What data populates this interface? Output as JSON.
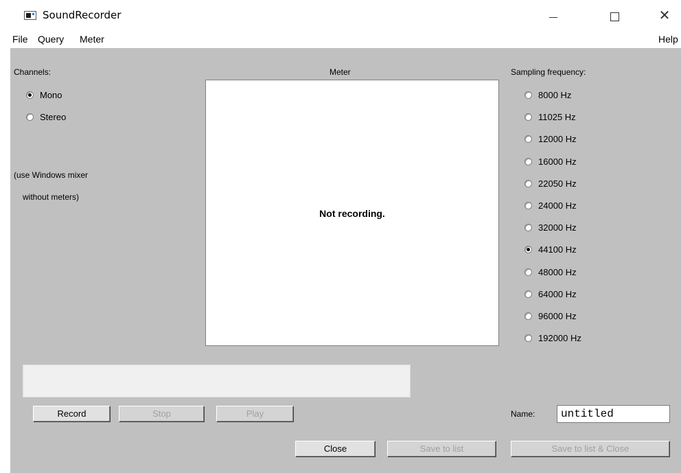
{
  "window": {
    "title": "SoundRecorder",
    "close_glyph": "✕"
  },
  "menu": {
    "items": [
      "File",
      "Query",
      "Meter"
    ],
    "help": "Help"
  },
  "channels": {
    "label": "Channels:",
    "options": [
      {
        "label": "Mono",
        "checked": true
      },
      {
        "label": "Stereo",
        "checked": false
      }
    ],
    "note_line1": "(use Windows mixer",
    "note_line2": "without meters)"
  },
  "meter": {
    "label": "Meter",
    "status": "Not recording."
  },
  "sampling": {
    "label": "Sampling frequency:",
    "options": [
      {
        "label": "8000 Hz",
        "checked": false
      },
      {
        "label": "11025 Hz",
        "checked": false
      },
      {
        "label": "12000 Hz",
        "checked": false
      },
      {
        "label": "16000 Hz",
        "checked": false
      },
      {
        "label": "22050 Hz",
        "checked": false
      },
      {
        "label": "24000 Hz",
        "checked": false
      },
      {
        "label": "32000 Hz",
        "checked": false
      },
      {
        "label": "44100 Hz",
        "checked": true
      },
      {
        "label": "48000 Hz",
        "checked": false
      },
      {
        "label": "64000 Hz",
        "checked": false
      },
      {
        "label": "96000 Hz",
        "checked": false
      },
      {
        "label": "192000 Hz",
        "checked": false
      }
    ]
  },
  "buttons": {
    "record": "Record",
    "stop": "Stop",
    "play": "Play",
    "close": "Close",
    "save_to_list": "Save to list",
    "save_to_list_close": "Save to list & Close"
  },
  "name": {
    "label": "Name:",
    "value": "untitled"
  }
}
